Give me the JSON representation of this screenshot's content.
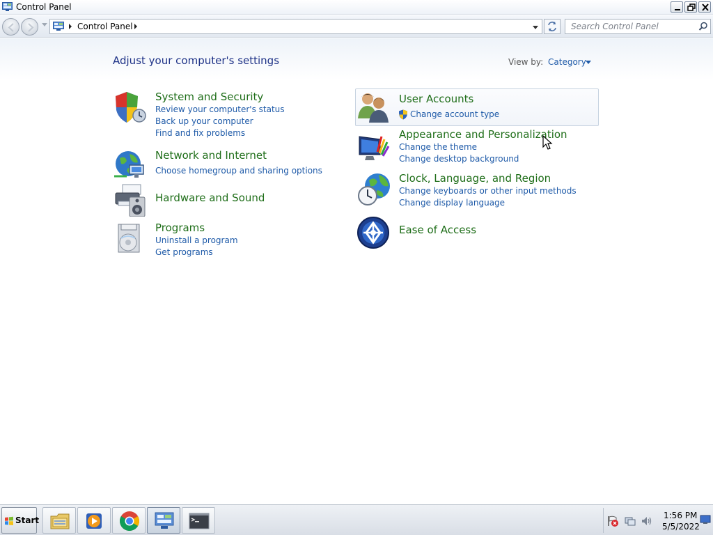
{
  "window": {
    "title": "Control Panel"
  },
  "address": {
    "path_label": "Control Panel",
    "search_placeholder": "Search Control Panel"
  },
  "content": {
    "heading": "Adjust your computer's settings",
    "view_by_label": "View by:",
    "view_by_value": "Category",
    "left_categories": [
      {
        "title": "System and Security",
        "icon": "shield-icon",
        "links": [
          "Review your computer's status",
          "Back up your computer",
          "Find and fix problems"
        ]
      },
      {
        "title": "Network and Internet",
        "icon": "globe-network-icon",
        "links": [
          "Choose homegroup and sharing options"
        ]
      },
      {
        "title": "Hardware and Sound",
        "icon": "printer-speaker-icon",
        "links": []
      },
      {
        "title": "Programs",
        "icon": "programs-disc-icon",
        "links": [
          "Uninstall a program",
          "Get programs"
        ]
      }
    ],
    "right_categories": [
      {
        "title": "User Accounts",
        "icon": "users-icon",
        "links": [
          "Change account type"
        ],
        "link_icon": "uac-shield-icon"
      },
      {
        "title": "Appearance and Personalization",
        "icon": "monitor-brush-icon",
        "links": [
          "Change the theme",
          "Change desktop background"
        ]
      },
      {
        "title": "Clock, Language, and Region",
        "icon": "clock-globe-icon",
        "links": [
          "Change keyboards or other input methods",
          "Change display language"
        ]
      },
      {
        "title": "Ease of Access",
        "icon": "ease-of-access-icon",
        "links": []
      }
    ]
  },
  "taskbar": {
    "start_label": "Start",
    "items": [
      {
        "name": "windows-explorer",
        "icon": "folder-icon"
      },
      {
        "name": "media-player",
        "icon": "media-player-icon"
      },
      {
        "name": "chrome",
        "icon": "chrome-icon"
      },
      {
        "name": "control-panel",
        "icon": "control-panel-icon",
        "active": true
      },
      {
        "name": "command-prompt",
        "icon": "cmd-icon"
      }
    ],
    "tray_icons": [
      "action-center-flag-icon",
      "network-icon",
      "volume-icon"
    ],
    "clock_time": "1:56 PM",
    "clock_date": "5/5/2022"
  },
  "colors": {
    "heading": "#1e3287",
    "category_title": "#1f6e19",
    "link": "#1e5aa8"
  }
}
